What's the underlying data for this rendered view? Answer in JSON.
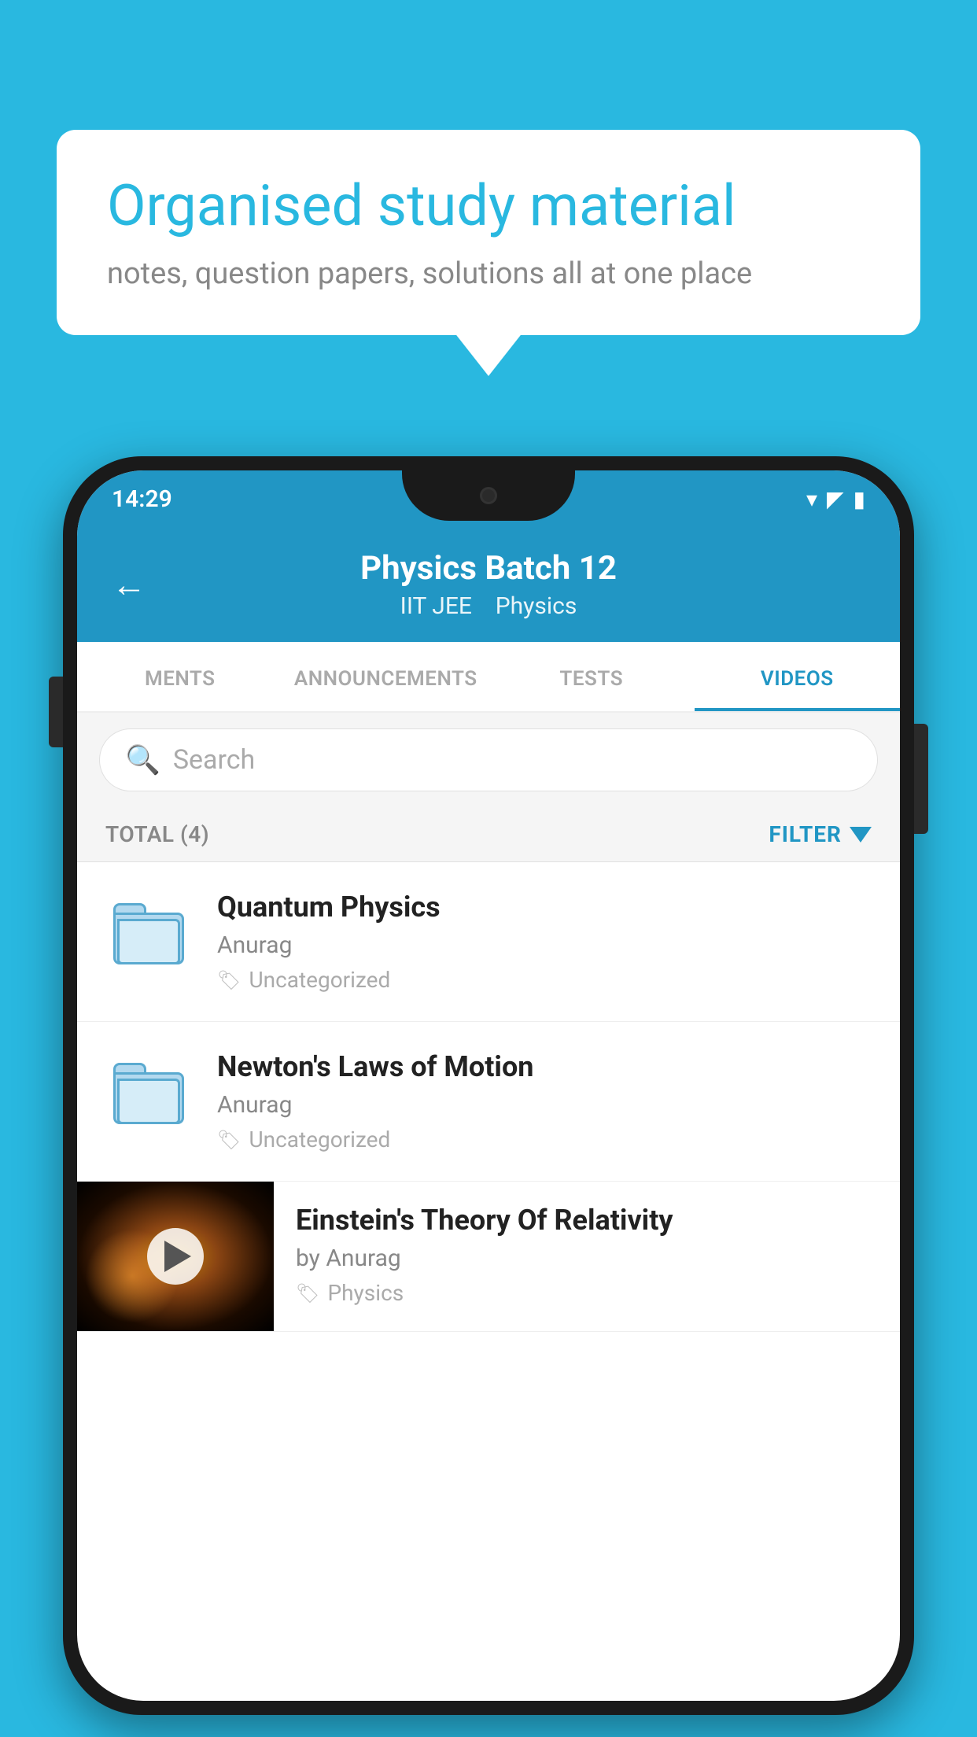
{
  "background": {
    "color": "#29b8e0"
  },
  "speech_bubble": {
    "title": "Organised study material",
    "subtitle": "notes, question papers, solutions all at one place"
  },
  "phone": {
    "status_bar": {
      "time": "14:29",
      "wifi": "▾",
      "signal": "▴",
      "battery": "▮"
    },
    "header": {
      "back_label": "←",
      "title": "Physics Batch 12",
      "subtitle_tag1": "IIT JEE",
      "subtitle_tag2": "Physics"
    },
    "tabs": [
      {
        "label": "MENTS",
        "active": false
      },
      {
        "label": "ANNOUNCEMENTS",
        "active": false
      },
      {
        "label": "TESTS",
        "active": false
      },
      {
        "label": "VIDEOS",
        "active": true
      }
    ],
    "search": {
      "placeholder": "Search"
    },
    "filter_row": {
      "total_label": "TOTAL (4)",
      "filter_label": "FILTER"
    },
    "videos": [
      {
        "id": 1,
        "title": "Quantum Physics",
        "author": "Anurag",
        "tag": "Uncategorized",
        "has_thumbnail": false
      },
      {
        "id": 2,
        "title": "Newton's Laws of Motion",
        "author": "Anurag",
        "tag": "Uncategorized",
        "has_thumbnail": false
      },
      {
        "id": 3,
        "title": "Einstein's Theory Of Relativity",
        "author": "by Anurag",
        "tag": "Physics",
        "has_thumbnail": true
      }
    ]
  }
}
